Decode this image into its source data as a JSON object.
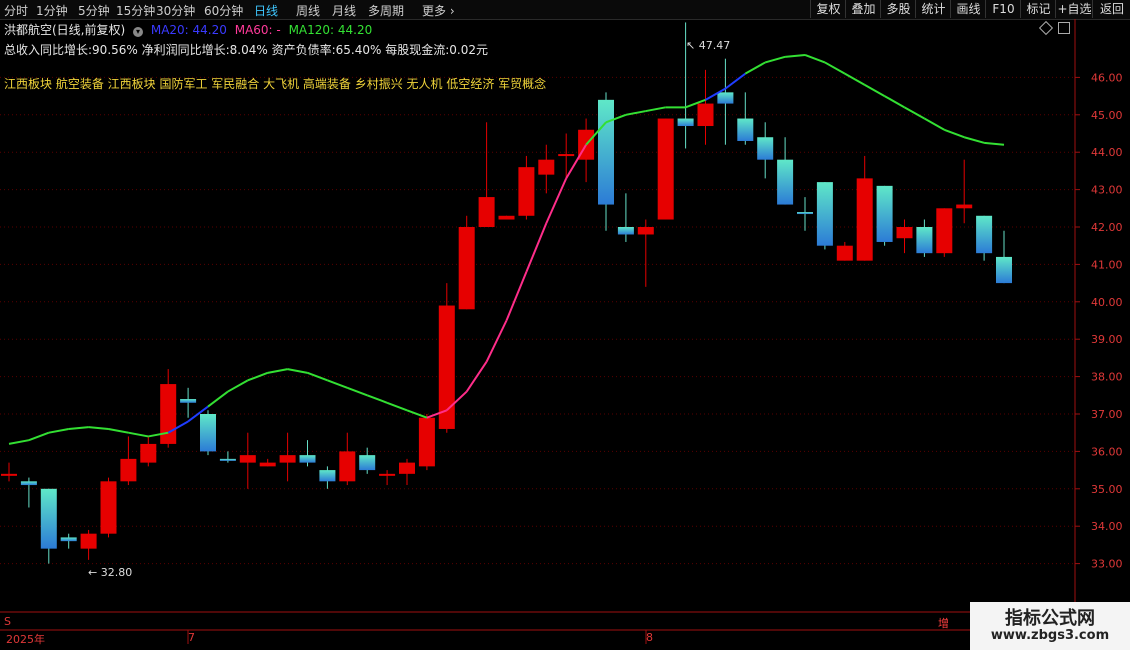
{
  "toolbar": {
    "timeframes": [
      "分时",
      "1分钟",
      "5分钟",
      "15分钟",
      "30分钟",
      "60分钟",
      "日线",
      "周线",
      "月线",
      "多周期",
      "更多"
    ],
    "active": "日线",
    "buttons": [
      "复权",
      "叠加",
      "多股",
      "统计",
      "画线",
      "F10",
      "标记",
      "+自选",
      "返回"
    ]
  },
  "header": {
    "title": "洪都航空(日线,前复权)",
    "ma20": "MA20: 44.20",
    "ma60": "MA60: -",
    "ma120": "MA120: 44.20",
    "info": "总收入同比增长:90.56%  净利润同比增长:8.04%  资产负债率:65.40%  每股现金流:0.02元",
    "tags": "江西板块 航空装备 江西板块 国防军工 军民融合 大飞机 高端装备 乡村振兴 无人机 低空经济 军贸概念"
  },
  "annotations": {
    "high": "47.47",
    "low": "32.80"
  },
  "bottom": {
    "year": "2025年",
    "m7": "7",
    "m8": "8",
    "zeng": "增",
    "s": "S"
  },
  "watermark": {
    "line1": "指标公式网",
    "line2": "www.zbgs3.com"
  },
  "colors": {
    "up": "#e60000",
    "down_top": "#5fe8c8",
    "down_bottom": "#2c7bd6",
    "ma": "#33e033",
    "ma_up": "#ff2d8a",
    "ma_down": "#1f3dff",
    "grid": "#5a0000"
  },
  "chart_data": {
    "type": "candlestick",
    "ylim": [
      32,
      47
    ],
    "yticks": [
      33,
      34,
      35,
      36,
      37,
      38,
      39,
      40,
      41,
      42,
      43,
      44,
      45,
      46
    ],
    "candles": [
      [
        35.4,
        35.4,
        35.7,
        35.2
      ],
      [
        35.2,
        35.1,
        35.3,
        34.5
      ],
      [
        35.0,
        33.4,
        35.0,
        33.0
      ],
      [
        33.7,
        33.6,
        33.8,
        33.4
      ],
      [
        33.4,
        33.8,
        33.9,
        33.1
      ],
      [
        33.8,
        35.2,
        35.3,
        33.7
      ],
      [
        35.2,
        35.8,
        36.4,
        35.1
      ],
      [
        35.7,
        36.2,
        36.4,
        35.6
      ],
      [
        36.2,
        37.8,
        38.2,
        36.1
      ],
      [
        37.4,
        37.3,
        37.7,
        36.9
      ],
      [
        37.0,
        36.0,
        37.1,
        35.9
      ],
      [
        35.8,
        35.75,
        36.0,
        35.7
      ],
      [
        35.7,
        35.9,
        36.5,
        35.0
      ],
      [
        35.6,
        35.7,
        35.8,
        35.6
      ],
      [
        35.7,
        35.9,
        36.5,
        35.2
      ],
      [
        35.9,
        35.7,
        36.3,
        35.6
      ],
      [
        35.5,
        35.2,
        35.6,
        35.0
      ],
      [
        35.2,
        36.0,
        36.5,
        35.1
      ],
      [
        35.9,
        35.5,
        36.1,
        35.4
      ],
      [
        35.4,
        35.4,
        35.5,
        35.1
      ],
      [
        35.4,
        35.7,
        35.8,
        35.1
      ],
      [
        35.6,
        36.9,
        37.0,
        35.5
      ],
      [
        36.6,
        39.9,
        40.5,
        36.5
      ],
      [
        39.8,
        42.0,
        42.3,
        39.8
      ],
      [
        42.0,
        42.8,
        44.8,
        42.0
      ],
      [
        42.2,
        42.3,
        42.3,
        42.2
      ],
      [
        42.3,
        43.6,
        43.9,
        42.2
      ],
      [
        43.4,
        43.8,
        44.2,
        42.9
      ],
      [
        43.9,
        43.95,
        44.5,
        43.3
      ],
      [
        43.8,
        44.6,
        44.9,
        43.2
      ],
      [
        45.4,
        42.6,
        45.6,
        41.9
      ],
      [
        42.0,
        41.8,
        42.9,
        41.6
      ],
      [
        41.8,
        42.0,
        42.2,
        40.4
      ],
      [
        42.2,
        44.9,
        44.9,
        42.2
      ],
      [
        44.9,
        44.7,
        47.47,
        44.1
      ],
      [
        44.7,
        45.3,
        46.2,
        44.2
      ],
      [
        45.6,
        45.3,
        46.5,
        44.2
      ],
      [
        44.9,
        44.3,
        45.6,
        44.2
      ],
      [
        44.4,
        43.8,
        44.8,
        43.3
      ],
      [
        43.8,
        42.6,
        44.4,
        42.6
      ],
      [
        42.4,
        42.35,
        42.8,
        41.9
      ],
      [
        43.2,
        41.5,
        43.2,
        41.4
      ],
      [
        41.1,
        41.5,
        41.6,
        41.1
      ],
      [
        41.1,
        43.3,
        43.9,
        41.1
      ],
      [
        43.1,
        41.6,
        43.1,
        41.5
      ],
      [
        41.7,
        42.0,
        42.2,
        41.3
      ],
      [
        42.0,
        41.3,
        42.2,
        41.2
      ],
      [
        41.3,
        42.5,
        42.5,
        41.2
      ],
      [
        42.5,
        42.6,
        43.8,
        42.1
      ],
      [
        42.3,
        41.3,
        42.3,
        41.1
      ],
      [
        41.2,
        40.5,
        41.9,
        40.5
      ]
    ],
    "ma": [
      36.2,
      36.3,
      36.5,
      36.6,
      36.65,
      36.6,
      36.5,
      36.4,
      36.5,
      36.8,
      37.2,
      37.6,
      37.9,
      38.1,
      38.2,
      38.1,
      37.9,
      37.7,
      37.5,
      37.3,
      37.1,
      36.9,
      37.1,
      37.6,
      38.4,
      39.5,
      40.8,
      42.1,
      43.3,
      44.2,
      44.8,
      45.0,
      45.1,
      45.2,
      45.2,
      45.4,
      45.7,
      46.1,
      46.4,
      46.55,
      46.6,
      46.4,
      46.1,
      45.8,
      45.5,
      45.2,
      44.9,
      44.6,
      44.4,
      44.25,
      44.2
    ]
  }
}
